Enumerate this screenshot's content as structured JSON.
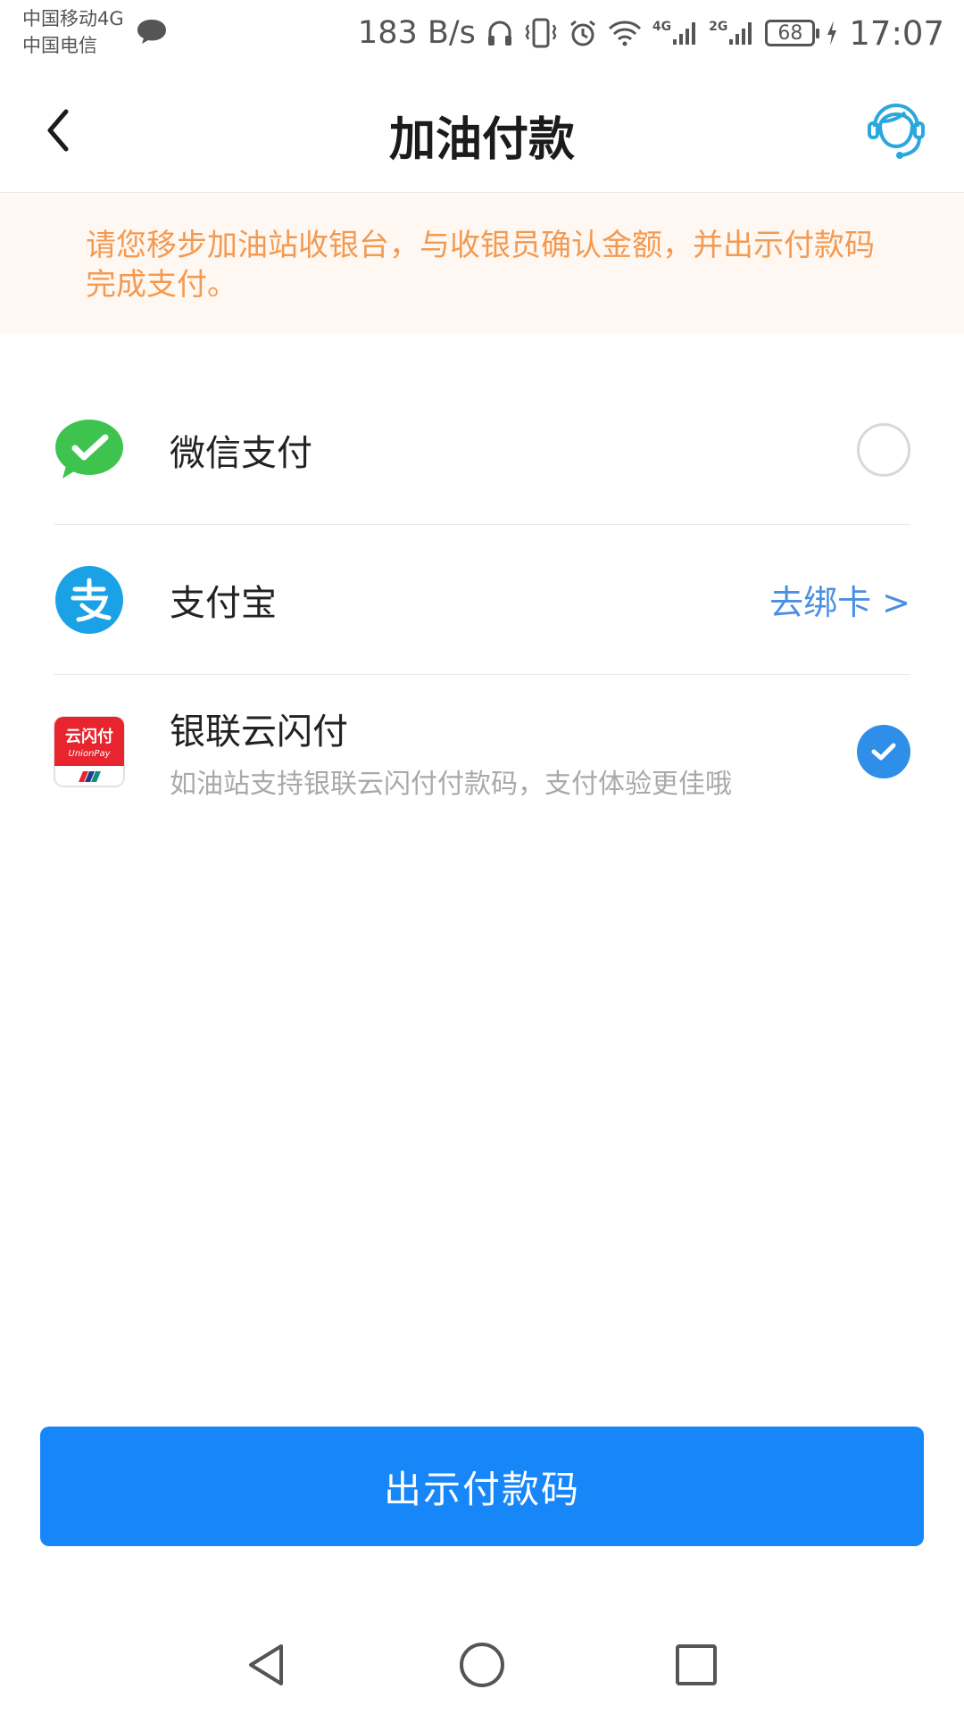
{
  "status_bar": {
    "carrier_1": "中国移动4G",
    "carrier_2": "中国电信",
    "net_speed": "183 B/s",
    "net_4g": "4G",
    "net_2g": "2G",
    "battery": "68",
    "time": "17:07"
  },
  "header": {
    "title": "加油付款",
    "back_icon": "chevron-left-icon",
    "support_icon": "customer-service-icon"
  },
  "notice": {
    "text": "请您移步加油站收银台，与收银员确认金额，并出示付款码完成支付。"
  },
  "payment_methods": [
    {
      "name": "微信支付",
      "icon": "wechat-pay-icon",
      "selected": false
    },
    {
      "name": "支付宝",
      "icon": "alipay-icon",
      "action": "去绑卡 >"
    },
    {
      "name": "银联云闪付",
      "subtitle": "如油站支持银联云闪付付款码，支付体验更佳哦",
      "icon": "unionpay-icon",
      "logo_text": "云闪付",
      "logo_subtext": "UnionPay",
      "selected": true
    }
  ],
  "primary_button": {
    "label": "出示付款码"
  },
  "colors": {
    "accent": "#1786f8",
    "notice_text": "#f39a52",
    "notice_bg": "#fff8f2",
    "link": "#4a8fe0",
    "check": "#2f8fe8"
  }
}
